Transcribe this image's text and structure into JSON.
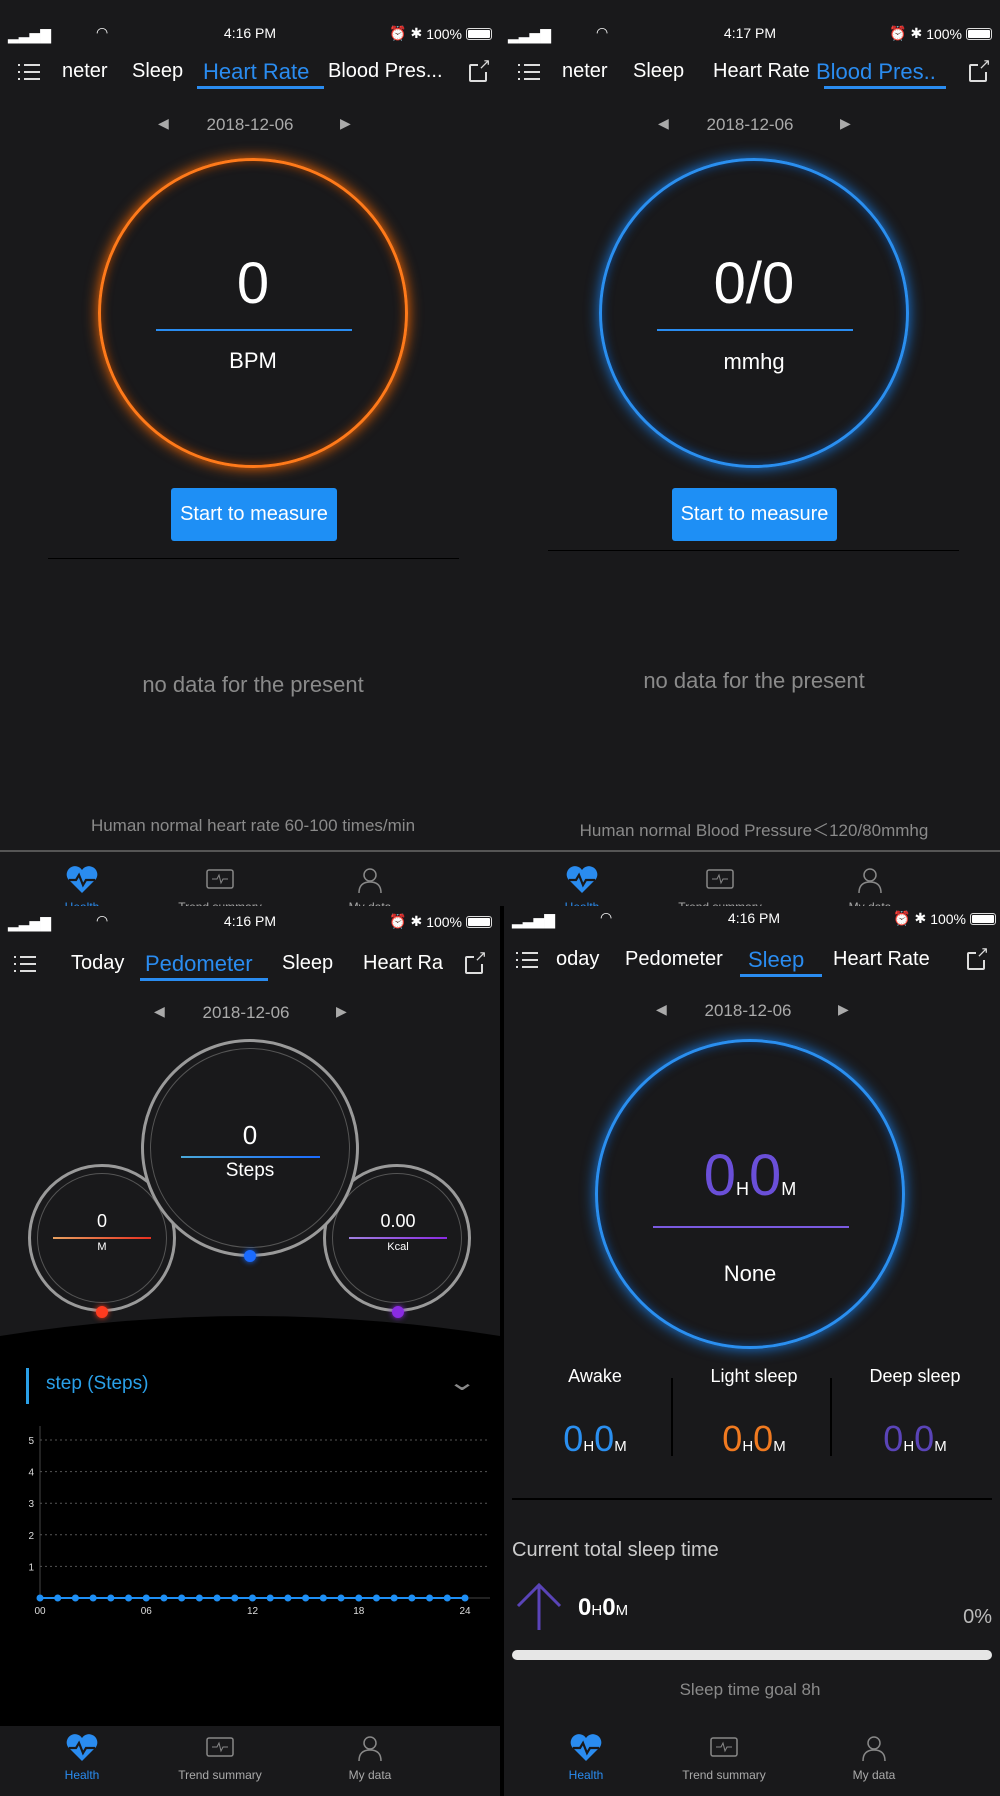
{
  "status_bars": [
    {
      "time": "4:16 PM",
      "battery": "100%"
    },
    {
      "time": "4:17 PM",
      "battery": "100%"
    },
    {
      "time": "4:16 PM",
      "battery": "100%"
    },
    {
      "time": "4:16 PM",
      "battery": "100%"
    }
  ],
  "heart_rate_screen": {
    "tabs": [
      "neter",
      "Sleep",
      "Heart Rate",
      "Blood Pres..."
    ],
    "active_tab": "Heart Rate",
    "date": "2018-12-06",
    "value": "0",
    "unit": "BPM",
    "measure_button": "Start to measure",
    "empty_text": "no data for the present",
    "footer_note": "Human normal heart rate 60-100 times/min"
  },
  "blood_pressure_screen": {
    "tabs": [
      "neter",
      "Sleep",
      "Heart Rate",
      "Blood Pres.."
    ],
    "active_tab": "Blood Pres..",
    "date": "2018-12-06",
    "value": "0/0",
    "unit": "mmhg",
    "measure_button": "Start to measure",
    "empty_text": "no data for the present",
    "footer_note": "Human normal Blood Pressure＜120/80mmhg"
  },
  "pedometer_screen": {
    "tabs": [
      "Today",
      "Pedometer",
      "Sleep",
      "Heart Ra"
    ],
    "active_tab": "Pedometer",
    "date": "2018-12-06",
    "steps": {
      "value": "0",
      "unit": "Steps"
    },
    "distance": {
      "value": "0",
      "unit": "M"
    },
    "calories": {
      "value": "0.00",
      "unit": "Kcal"
    },
    "chart_title": "step (Steps)"
  },
  "sleep_screen": {
    "tabs": [
      "oday",
      "Pedometer",
      "Sleep",
      "Heart Rate"
    ],
    "active_tab": "Sleep",
    "date": "2018-12-06",
    "total": {
      "h": "0",
      "m": "0",
      "h_label": "H",
      "m_label": "M"
    },
    "quality": "None",
    "stages": [
      {
        "label": "Awake",
        "h": "0",
        "m": "0",
        "color": "#2a8ff0"
      },
      {
        "label": "Light sleep",
        "h": "0",
        "m": "0",
        "color": "#f07a20"
      },
      {
        "label": "Deep sleep",
        "h": "0",
        "m": "0",
        "color": "#5a44b8"
      }
    ],
    "current_total_label": "Current total sleep time",
    "current_total": {
      "h": "0",
      "m": "0"
    },
    "progress_percent": "0%",
    "progress": 0,
    "goal_text": "Sleep time goal 8h"
  },
  "bottom_nav": [
    {
      "label": "Health",
      "icon": "heart-pulse-icon",
      "active": true
    },
    {
      "label": "Trend summary",
      "icon": "trend-monitor-icon",
      "active": false
    },
    {
      "label": "My data",
      "icon": "user-icon",
      "active": false
    }
  ],
  "colors": {
    "accent": "#2a8cf0",
    "heart_ring": "#ff7a1a",
    "bp_ring": "#2a8ff0",
    "background": "#19191b",
    "distance": "#ff3b1f",
    "steps": "#1a6bff",
    "calories": "#8a2be2"
  },
  "chart_data": {
    "type": "line",
    "title": "step (Steps)",
    "x": [
      "00",
      "01",
      "02",
      "03",
      "04",
      "05",
      "06",
      "07",
      "08",
      "09",
      "10",
      "11",
      "12",
      "13",
      "14",
      "15",
      "16",
      "17",
      "18",
      "19",
      "20",
      "21",
      "22",
      "23",
      "24"
    ],
    "values": [
      0,
      0,
      0,
      0,
      0,
      0,
      0,
      0,
      0,
      0,
      0,
      0,
      0,
      0,
      0,
      0,
      0,
      0,
      0,
      0,
      0,
      0,
      0,
      0,
      0
    ],
    "x_ticks": [
      "00",
      "06",
      "12",
      "18",
      "24"
    ],
    "y_ticks": [
      "1",
      "2",
      "3",
      "4",
      "5"
    ],
    "ylim": [
      0,
      5.5
    ],
    "grid": "horizontal dotted",
    "color": "#1e8ff5"
  }
}
